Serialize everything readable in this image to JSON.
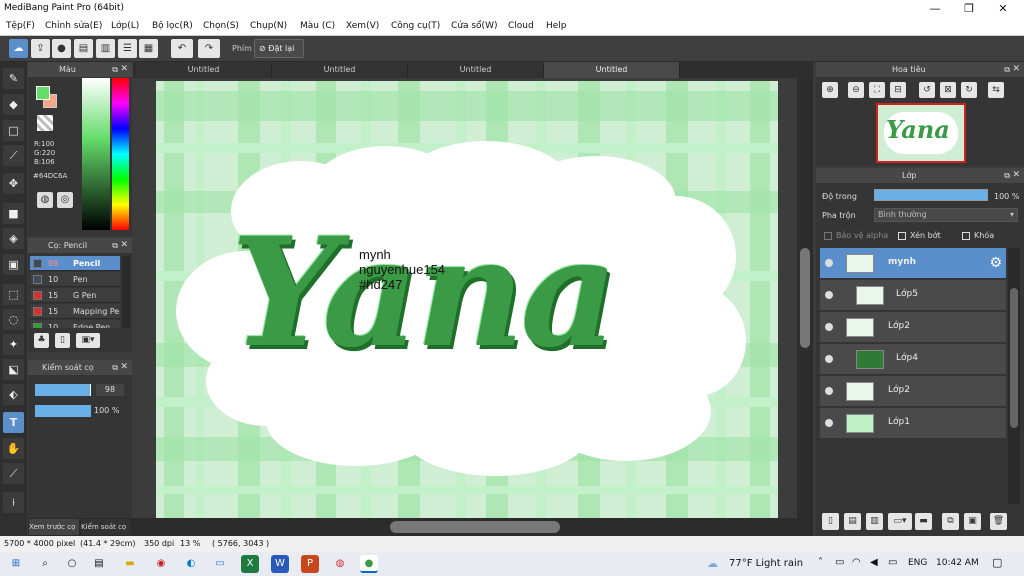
{
  "window": {
    "title": "MediBang Paint Pro (64bit)",
    "min": "—",
    "max": "❐",
    "close": "✕"
  },
  "menu": [
    "Tệp(F)",
    "Chỉnh sửa(E)",
    "Lớp(L)",
    "Bộ lọc(R)",
    "Chọn(S)",
    "Chụp(N)",
    "Màu (C)",
    "Xem(V)",
    "Công cụ(T)",
    "Cửa sổ(W)",
    "Cloud",
    "Help"
  ],
  "toolbar": {
    "shortcut_label": "Phím",
    "reset_label": "Đặt lại"
  },
  "tabs": [
    "Untitled",
    "Untitled",
    "Untitled",
    "Untitled"
  ],
  "color_panel": {
    "title": "Màu",
    "r": "R:100",
    "g": "G:220",
    "b": "B:106",
    "hex": "#64DC6A",
    "fg_color": "#64dc6a",
    "bg_color": "#f5a58a"
  },
  "brush_panel": {
    "title": "Cọ: Pencil",
    "items": [
      {
        "size": "98",
        "name": "Pencil",
        "color": "#3a4a5a"
      },
      {
        "size": "10",
        "name": "Pen",
        "color": "#3a4a5a"
      },
      {
        "size": "15",
        "name": "G Pen",
        "color": "#d83030"
      },
      {
        "size": "15",
        "name": "Mapping Pen",
        "color": "#d83030"
      },
      {
        "size": "10",
        "name": "Edge Pen",
        "color": "#30a030"
      }
    ]
  },
  "brush_control": {
    "title": "Kiểm soát cọ",
    "size_value": "98",
    "opacity_value": "100 %",
    "size_fraction": 0.98,
    "opacity_fraction": 1.0
  },
  "bottom_left_tabs": [
    "Xem trước cọ",
    "Kiểm soát cọ"
  ],
  "canvas": {
    "title_text": "Yana",
    "sig_line1": "mynh",
    "sig_line2": "nguyenhue154",
    "sig_line3": "#hd247"
  },
  "navigator": {
    "title": "Hoa tiêu",
    "thumb_text": "Yana"
  },
  "layer_panel": {
    "title": "Lớp",
    "opacity_label": "Độ trong",
    "opacity_value": "100 %",
    "blend_label": "Pha trộn",
    "blend_value": "Bình thường",
    "protect_alpha": "Bảo vệ alpha",
    "clipping": "Xén bớt",
    "lock": "Khóa",
    "layers": [
      "mynh",
      "Lớp5",
      "Lớp2",
      "Lớp4",
      "Lớp2",
      "Lớp1"
    ]
  },
  "status": {
    "size": "5700 * 4000 pixel",
    "dims": "(41.4 * 29cm)",
    "dpi": "350 dpi",
    "zoom": "13 %",
    "coords": "( 5766, 3043 )"
  },
  "taskbar": {
    "weather": "77°F  Light rain",
    "lang": "ENG",
    "time": "10:42 AM"
  }
}
